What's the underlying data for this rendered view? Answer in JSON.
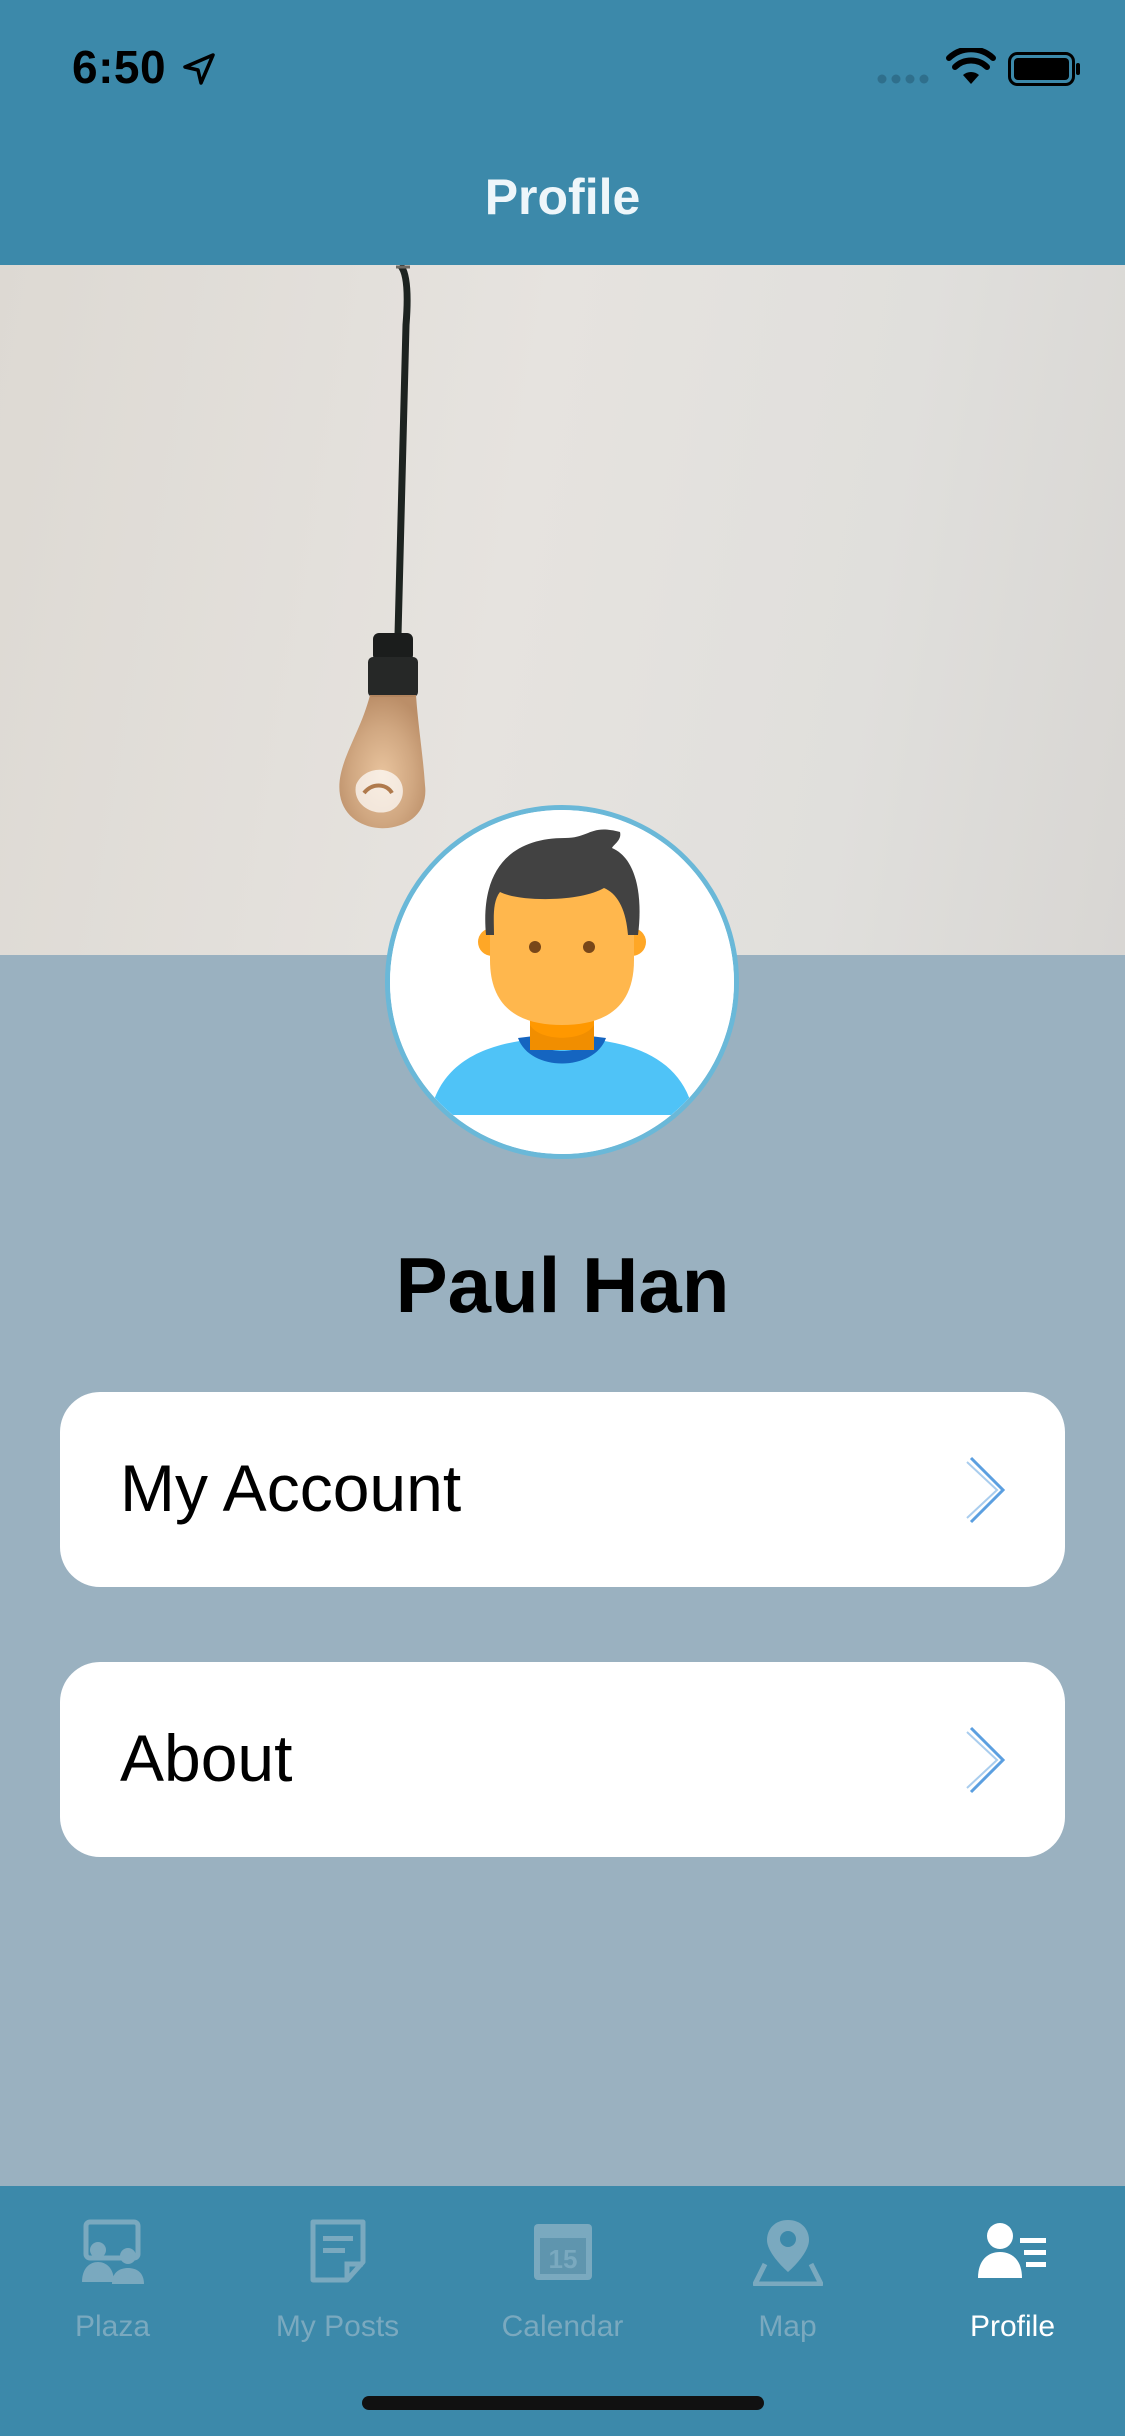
{
  "status_bar": {
    "time": "6:50",
    "icons": [
      "location-arrow-icon",
      "cellular-signal-icon",
      "wifi-icon",
      "battery-icon"
    ]
  },
  "header": {
    "title": "Profile"
  },
  "cover_image": {
    "description_icon": "hanging-light-bulb-photo"
  },
  "profile": {
    "name": "Paul Han",
    "avatar_icon": "user-avatar-icon"
  },
  "menu": {
    "items": [
      {
        "label": "My Account",
        "icon": "chevron-right-icon"
      },
      {
        "label": "About",
        "icon": "chevron-right-icon"
      }
    ]
  },
  "tab_bar": {
    "tabs": [
      {
        "label": "Plaza",
        "icon": "plaza-icon",
        "active": false
      },
      {
        "label": "My Posts",
        "icon": "posts-icon",
        "active": false
      },
      {
        "label": "Calendar",
        "icon": "calendar-icon",
        "badge": "15",
        "active": false
      },
      {
        "label": "Map",
        "icon": "map-pin-icon",
        "active": false
      },
      {
        "label": "Profile",
        "icon": "profile-list-icon",
        "active": true
      }
    ]
  },
  "colors": {
    "bar_background": "#3c89aa",
    "page_background": "#9ab1c0",
    "tab_inactive": "#7aa9bf",
    "tab_active": "#ffffff",
    "chevron": "#5b9fe0"
  }
}
